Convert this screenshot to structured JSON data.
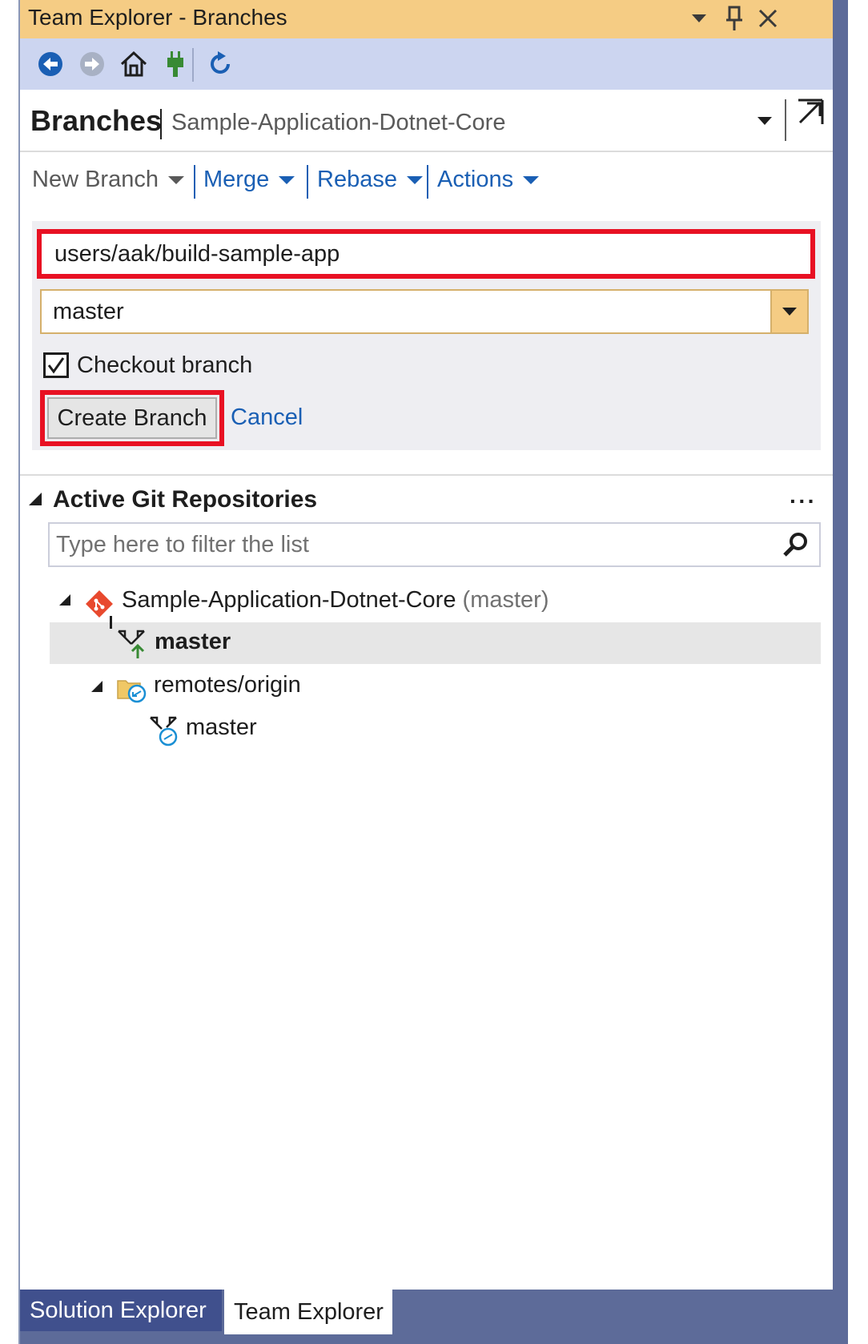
{
  "window": {
    "title": "Team Explorer - Branches"
  },
  "header": {
    "title": "Branches",
    "subtitle": "Sample-Application-Dotnet-Core"
  },
  "actions": {
    "new_branch": "New Branch",
    "merge": "Merge",
    "rebase": "Rebase",
    "actions": "Actions"
  },
  "new_branch_form": {
    "branch_name_value": "users/aak/build-sample-app",
    "base_branch_selected": "master",
    "checkout_label": "Checkout branch",
    "checkout_checked": true,
    "create_label": "Create Branch",
    "cancel_label": "Cancel"
  },
  "repos": {
    "section_title": "Active Git Repositories",
    "more_label": "···",
    "filter_placeholder": "Type here to filter the list",
    "repo_name": "Sample-Application-Dotnet-Core",
    "repo_branch": "(master)",
    "local_branch": "master",
    "remote_folder": "remotes/origin",
    "remote_branch": "master"
  },
  "bottom_tabs": {
    "solution_explorer": "Solution Explorer",
    "team_explorer": "Team Explorer"
  },
  "colors": {
    "title_bar": "#f5cc84",
    "toolbar": "#ccd5f0",
    "highlight_red": "#e81123",
    "link_blue": "#1a5fb4",
    "git_orange": "#e8492e"
  }
}
